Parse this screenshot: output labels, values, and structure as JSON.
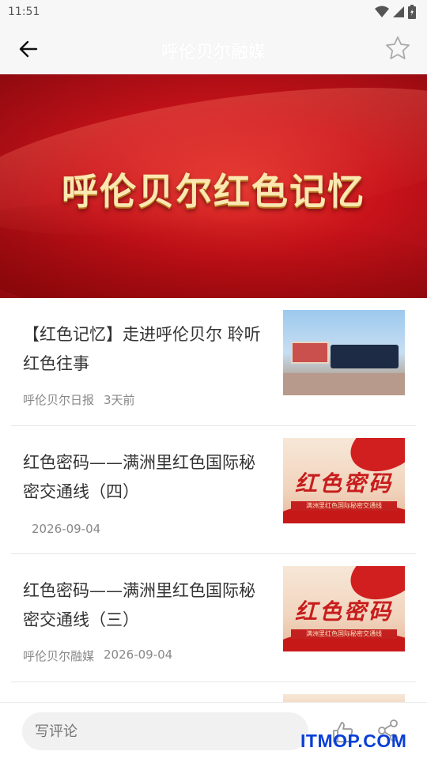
{
  "status_bar": {
    "time": "11:51",
    "icons": [
      "wifi-icon",
      "signal-icon",
      "battery-icon"
    ]
  },
  "top_bar": {
    "title": "呼伦贝尔融媒",
    "back_icon": "arrow-left-icon",
    "favorite_icon": "star-icon"
  },
  "banner": {
    "title": "呼伦贝尔红色记忆"
  },
  "articles": [
    {
      "title": "【红色记忆】走进呼伦贝尔 聆听红色往事",
      "source": "呼伦贝尔日报",
      "time": "3天前"
    },
    {
      "title": "红色密码——满洲里红色国际秘密交通线（四）",
      "source": "",
      "time": "2026-09-04"
    },
    {
      "title": "红色密码——满洲里红色国际秘密交通线（三）",
      "source": "呼伦贝尔融媒",
      "time": "2026-09-04"
    }
  ],
  "thumb_text": {
    "big": "红色密码",
    "small": "满洲里红色国际秘密交通线"
  },
  "bottom_bar": {
    "comment_placeholder": "写评论",
    "like_icon": "thumbs-up-icon",
    "share_icon": "share-icon"
  },
  "watermark": "ITMOP.COM",
  "colors": {
    "banner_red": "#c8121a",
    "watermark_blue": "#0a3fd6"
  }
}
